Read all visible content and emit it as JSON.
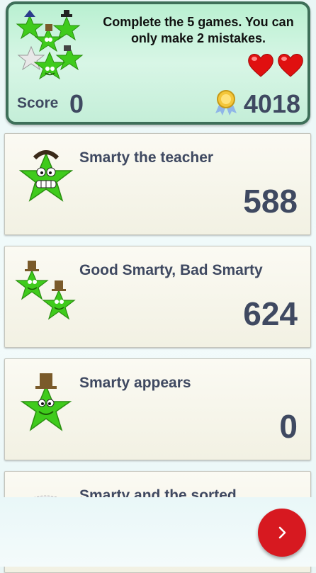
{
  "header": {
    "instructions": "Complete the 5 games. You can only make 2 mistakes.",
    "lives": 2,
    "score_label": "Score",
    "score_value": "0",
    "points_value": "4018",
    "icons": {
      "mascots": "smarty-group-icon",
      "life": "heart-icon",
      "points": "medal-icon"
    }
  },
  "games": [
    {
      "title": "Smarty the teacher",
      "score": "588",
      "icon": "smarty-teacher-icon"
    },
    {
      "title": "Good Smarty, Bad Smarty",
      "score": "624",
      "icon": "smarty-pair-icon"
    },
    {
      "title": "Smarty appears",
      "score": "0",
      "icon": "smarty-top-hat-icon"
    },
    {
      "title": "Smarty and the sorted",
      "score": "",
      "icon": "smarty-fuzzy-icon"
    }
  ],
  "next_button": {
    "icon": "chevron-right-icon",
    "color": "#d71920"
  },
  "colors": {
    "text": "#3f4961",
    "star_green": "#3fcb1c",
    "header_border": "#3e6f59"
  }
}
